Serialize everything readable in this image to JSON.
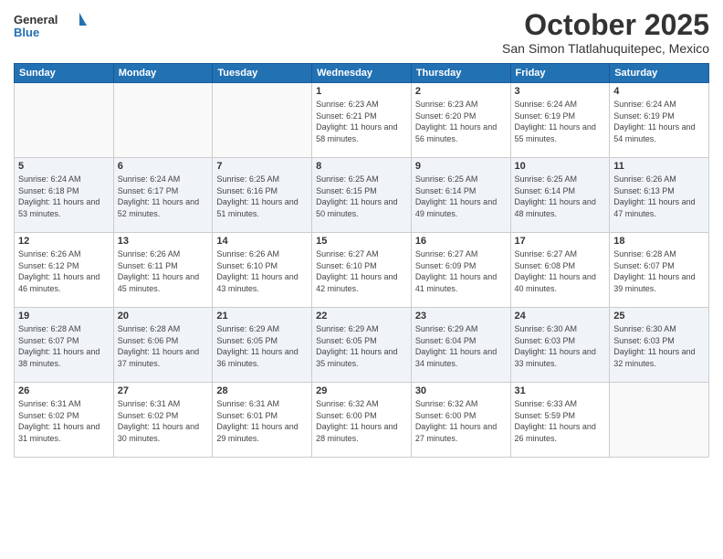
{
  "logo": {
    "general": "General",
    "blue": "Blue"
  },
  "title": "October 2025",
  "location": "San Simon Tlatlahuquitepec, Mexico",
  "weekdays": [
    "Sunday",
    "Monday",
    "Tuesday",
    "Wednesday",
    "Thursday",
    "Friday",
    "Saturday"
  ],
  "weeks": [
    [
      {
        "day": "",
        "sunrise": "",
        "sunset": "",
        "daylight": ""
      },
      {
        "day": "",
        "sunrise": "",
        "sunset": "",
        "daylight": ""
      },
      {
        "day": "",
        "sunrise": "",
        "sunset": "",
        "daylight": ""
      },
      {
        "day": "1",
        "sunrise": "Sunrise: 6:23 AM",
        "sunset": "Sunset: 6:21 PM",
        "daylight": "Daylight: 11 hours and 58 minutes."
      },
      {
        "day": "2",
        "sunrise": "Sunrise: 6:23 AM",
        "sunset": "Sunset: 6:20 PM",
        "daylight": "Daylight: 11 hours and 56 minutes."
      },
      {
        "day": "3",
        "sunrise": "Sunrise: 6:24 AM",
        "sunset": "Sunset: 6:19 PM",
        "daylight": "Daylight: 11 hours and 55 minutes."
      },
      {
        "day": "4",
        "sunrise": "Sunrise: 6:24 AM",
        "sunset": "Sunset: 6:19 PM",
        "daylight": "Daylight: 11 hours and 54 minutes."
      }
    ],
    [
      {
        "day": "5",
        "sunrise": "Sunrise: 6:24 AM",
        "sunset": "Sunset: 6:18 PM",
        "daylight": "Daylight: 11 hours and 53 minutes."
      },
      {
        "day": "6",
        "sunrise": "Sunrise: 6:24 AM",
        "sunset": "Sunset: 6:17 PM",
        "daylight": "Daylight: 11 hours and 52 minutes."
      },
      {
        "day": "7",
        "sunrise": "Sunrise: 6:25 AM",
        "sunset": "Sunset: 6:16 PM",
        "daylight": "Daylight: 11 hours and 51 minutes."
      },
      {
        "day": "8",
        "sunrise": "Sunrise: 6:25 AM",
        "sunset": "Sunset: 6:15 PM",
        "daylight": "Daylight: 11 hours and 50 minutes."
      },
      {
        "day": "9",
        "sunrise": "Sunrise: 6:25 AM",
        "sunset": "Sunset: 6:14 PM",
        "daylight": "Daylight: 11 hours and 49 minutes."
      },
      {
        "day": "10",
        "sunrise": "Sunrise: 6:25 AM",
        "sunset": "Sunset: 6:14 PM",
        "daylight": "Daylight: 11 hours and 48 minutes."
      },
      {
        "day": "11",
        "sunrise": "Sunrise: 6:26 AM",
        "sunset": "Sunset: 6:13 PM",
        "daylight": "Daylight: 11 hours and 47 minutes."
      }
    ],
    [
      {
        "day": "12",
        "sunrise": "Sunrise: 6:26 AM",
        "sunset": "Sunset: 6:12 PM",
        "daylight": "Daylight: 11 hours and 46 minutes."
      },
      {
        "day": "13",
        "sunrise": "Sunrise: 6:26 AM",
        "sunset": "Sunset: 6:11 PM",
        "daylight": "Daylight: 11 hours and 45 minutes."
      },
      {
        "day": "14",
        "sunrise": "Sunrise: 6:26 AM",
        "sunset": "Sunset: 6:10 PM",
        "daylight": "Daylight: 11 hours and 43 minutes."
      },
      {
        "day": "15",
        "sunrise": "Sunrise: 6:27 AM",
        "sunset": "Sunset: 6:10 PM",
        "daylight": "Daylight: 11 hours and 42 minutes."
      },
      {
        "day": "16",
        "sunrise": "Sunrise: 6:27 AM",
        "sunset": "Sunset: 6:09 PM",
        "daylight": "Daylight: 11 hours and 41 minutes."
      },
      {
        "day": "17",
        "sunrise": "Sunrise: 6:27 AM",
        "sunset": "Sunset: 6:08 PM",
        "daylight": "Daylight: 11 hours and 40 minutes."
      },
      {
        "day": "18",
        "sunrise": "Sunrise: 6:28 AM",
        "sunset": "Sunset: 6:07 PM",
        "daylight": "Daylight: 11 hours and 39 minutes."
      }
    ],
    [
      {
        "day": "19",
        "sunrise": "Sunrise: 6:28 AM",
        "sunset": "Sunset: 6:07 PM",
        "daylight": "Daylight: 11 hours and 38 minutes."
      },
      {
        "day": "20",
        "sunrise": "Sunrise: 6:28 AM",
        "sunset": "Sunset: 6:06 PM",
        "daylight": "Daylight: 11 hours and 37 minutes."
      },
      {
        "day": "21",
        "sunrise": "Sunrise: 6:29 AM",
        "sunset": "Sunset: 6:05 PM",
        "daylight": "Daylight: 11 hours and 36 minutes."
      },
      {
        "day": "22",
        "sunrise": "Sunrise: 6:29 AM",
        "sunset": "Sunset: 6:05 PM",
        "daylight": "Daylight: 11 hours and 35 minutes."
      },
      {
        "day": "23",
        "sunrise": "Sunrise: 6:29 AM",
        "sunset": "Sunset: 6:04 PM",
        "daylight": "Daylight: 11 hours and 34 minutes."
      },
      {
        "day": "24",
        "sunrise": "Sunrise: 6:30 AM",
        "sunset": "Sunset: 6:03 PM",
        "daylight": "Daylight: 11 hours and 33 minutes."
      },
      {
        "day": "25",
        "sunrise": "Sunrise: 6:30 AM",
        "sunset": "Sunset: 6:03 PM",
        "daylight": "Daylight: 11 hours and 32 minutes."
      }
    ],
    [
      {
        "day": "26",
        "sunrise": "Sunrise: 6:31 AM",
        "sunset": "Sunset: 6:02 PM",
        "daylight": "Daylight: 11 hours and 31 minutes."
      },
      {
        "day": "27",
        "sunrise": "Sunrise: 6:31 AM",
        "sunset": "Sunset: 6:02 PM",
        "daylight": "Daylight: 11 hours and 30 minutes."
      },
      {
        "day": "28",
        "sunrise": "Sunrise: 6:31 AM",
        "sunset": "Sunset: 6:01 PM",
        "daylight": "Daylight: 11 hours and 29 minutes."
      },
      {
        "day": "29",
        "sunrise": "Sunrise: 6:32 AM",
        "sunset": "Sunset: 6:00 PM",
        "daylight": "Daylight: 11 hours and 28 minutes."
      },
      {
        "day": "30",
        "sunrise": "Sunrise: 6:32 AM",
        "sunset": "Sunset: 6:00 PM",
        "daylight": "Daylight: 11 hours and 27 minutes."
      },
      {
        "day": "31",
        "sunrise": "Sunrise: 6:33 AM",
        "sunset": "Sunset: 5:59 PM",
        "daylight": "Daylight: 11 hours and 26 minutes."
      },
      {
        "day": "",
        "sunrise": "",
        "sunset": "",
        "daylight": ""
      }
    ]
  ]
}
